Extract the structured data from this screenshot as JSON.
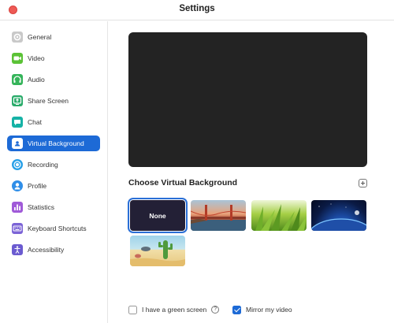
{
  "window": {
    "title": "Settings"
  },
  "sidebar": {
    "items": [
      {
        "label": "General",
        "icon": "gear-icon",
        "color": "#c9c9c9"
      },
      {
        "label": "Video",
        "icon": "video-camera-icon",
        "color": "#5bc236"
      },
      {
        "label": "Audio",
        "icon": "headphones-icon",
        "color": "#35b45a"
      },
      {
        "label": "Share Screen",
        "icon": "share-screen-icon",
        "color": "#2aab6a"
      },
      {
        "label": "Chat",
        "icon": "chat-bubble-icon",
        "color": "#16b2a6"
      },
      {
        "label": "Virtual Background",
        "icon": "person-portrait-icon",
        "color": "#ffffff"
      },
      {
        "label": "Recording",
        "icon": "record-icon",
        "color": "#27a0e8"
      },
      {
        "label": "Profile",
        "icon": "person-icon",
        "color": "#2f8ee8"
      },
      {
        "label": "Statistics",
        "icon": "bar-chart-icon",
        "color": "#a05ad8"
      },
      {
        "label": "Keyboard Shortcuts",
        "icon": "keyboard-icon",
        "color": "#7b63d6"
      },
      {
        "label": "Accessibility",
        "icon": "accessibility-icon",
        "color": "#6b5bd0"
      }
    ],
    "active_index": 5,
    "active_color": "#1d6ad6"
  },
  "main": {
    "section_title": "Choose Virtual Background",
    "backgrounds": [
      {
        "label": "None",
        "selected": true
      },
      {
        "label": "",
        "selected": false
      },
      {
        "label": "",
        "selected": false
      },
      {
        "label": "",
        "selected": false
      },
      {
        "label": "",
        "selected": false
      }
    ],
    "green_screen_label": "I have a green screen",
    "green_screen_checked": false,
    "mirror_label": "Mirror my video",
    "mirror_checked": true,
    "help_glyph": "?"
  }
}
